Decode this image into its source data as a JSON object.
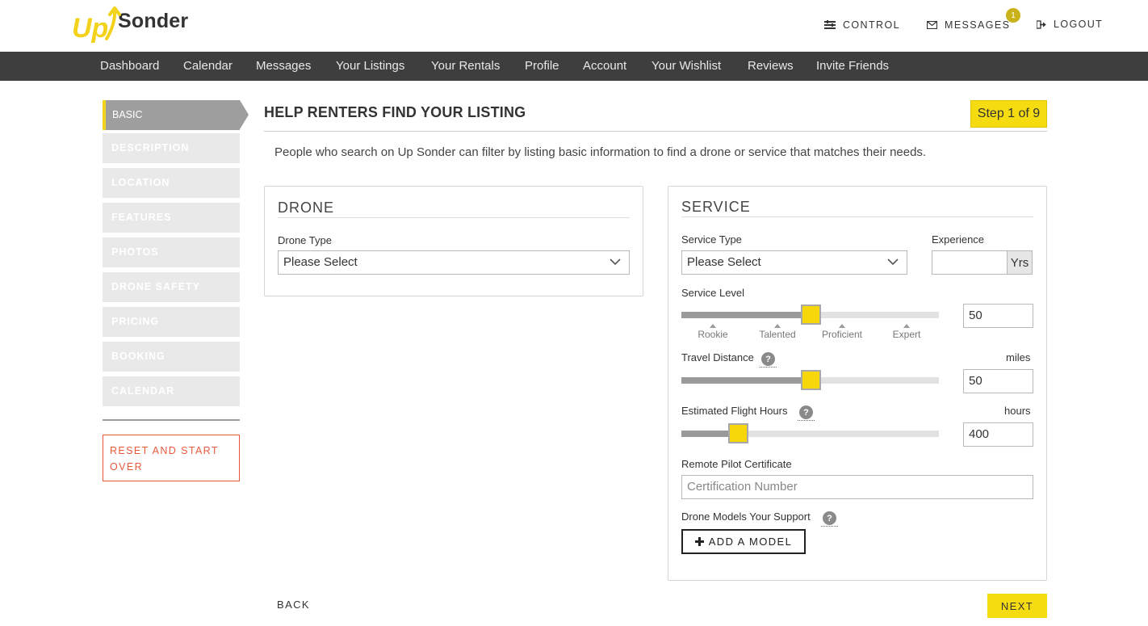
{
  "header": {
    "brand_mark": "Up",
    "brand_name": "Sonder",
    "links": {
      "control": "CONTROL",
      "messages": "MESSAGES",
      "messages_badge": "1",
      "logout": "LOGOUT"
    }
  },
  "nav": {
    "items": [
      "Dashboard",
      "Calendar",
      "Messages",
      "Your Listings",
      "Your Rentals",
      "Profile",
      "Account",
      "Your Wishlist",
      "Reviews",
      "Invite Friends"
    ]
  },
  "sidebar": {
    "items": [
      "BASIC",
      "DESCRIPTION",
      "LOCATION",
      "FEATURES",
      "PHOTOS",
      "DRONE SAFETY",
      "PRICING",
      "BOOKING",
      "CALENDAR"
    ],
    "active_index": 0,
    "reset_label": "RESET AND START OVER"
  },
  "main": {
    "title": "HELP RENTERS FIND YOUR LISTING",
    "step": "Step 1 of 9",
    "intro": "People who search on Up Sonder can filter by listing basic information to find a drone or service that matches their needs."
  },
  "drone_panel": {
    "title": "DRONE",
    "drone_type_label": "Drone Type",
    "drone_type_value": "Please Select"
  },
  "service_panel": {
    "title": "SERVICE",
    "service_type_label": "Service Type",
    "service_type_value": "Please Select",
    "experience_label": "Experience",
    "experience_value": "",
    "experience_unit": "Yrs",
    "service_level": {
      "label": "Service Level",
      "value": "50",
      "fraction": 0.5,
      "ticks": [
        "Rookie",
        "Talented",
        "Proficient",
        "Expert"
      ]
    },
    "travel_distance": {
      "label": "Travel Distance",
      "unit": "miles",
      "value": "50",
      "fraction": 0.5
    },
    "flight_hours": {
      "label": "Estimated Flight Hours",
      "unit": "hours",
      "value": "400",
      "fraction": 0.22
    },
    "certificate": {
      "label": "Remote Pilot Certificate",
      "placeholder": "Certification Number"
    },
    "models": {
      "label": "Drone Models Your Support",
      "add_label": "ADD A MODEL"
    },
    "help_glyph": "?"
  },
  "footer": {
    "back_label": "BACK",
    "next_label": "NEXT"
  },
  "colors": {
    "accent_yellow": "#f5dc10",
    "nav_bg": "#3e3e3e",
    "reset_red": "#e8593b",
    "sidebar_active": "#9e9e9e"
  }
}
